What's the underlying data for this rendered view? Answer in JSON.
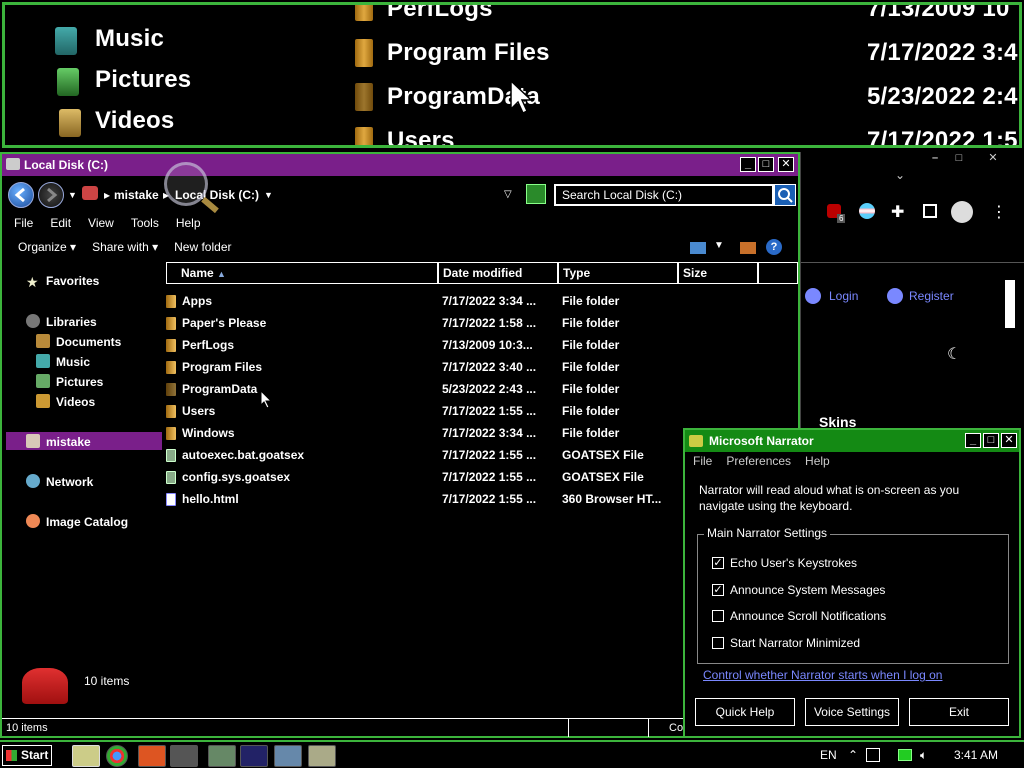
{
  "magnifier": {
    "left_items": [
      "Music",
      "Pictures",
      "Videos"
    ],
    "right_items": [
      {
        "name": "PerfLogs",
        "date": "7/13/2009 10"
      },
      {
        "name": "Program Files",
        "date": "7/17/2022 3:4"
      },
      {
        "name": "ProgramData",
        "date": "5/23/2022 2:4"
      },
      {
        "name": "Users",
        "date": "7/17/2022 1:5"
      }
    ]
  },
  "explorer": {
    "title": "Local Disk (C:)",
    "breadcrumb": [
      "mistake",
      "Local Disk (C:)"
    ],
    "search_placeholder": "Search Local Disk (C:)",
    "menu": [
      "File",
      "Edit",
      "View",
      "Tools",
      "Help"
    ],
    "toolbar": [
      "Organize",
      "Share with",
      "New folder"
    ],
    "nav": {
      "favorites": "Favorites",
      "libraries": "Libraries",
      "lib_items": [
        "Documents",
        "Music",
        "Pictures",
        "Videos"
      ],
      "user": "mistake",
      "network": "Network",
      "image_catalog": "Image Catalog"
    },
    "columns": [
      "Name",
      "Date modified",
      "Type",
      "Size"
    ],
    "files": [
      {
        "name": "Apps",
        "date": "7/17/2022 3:34 ...",
        "type": "File folder",
        "kind": "folder"
      },
      {
        "name": "Paper's Please",
        "date": "7/17/2022 1:58 ...",
        "type": "File folder",
        "kind": "folder"
      },
      {
        "name": "PerfLogs",
        "date": "7/13/2009 10:3...",
        "type": "File folder",
        "kind": "folder"
      },
      {
        "name": "Program Files",
        "date": "7/17/2022 3:40 ...",
        "type": "File folder",
        "kind": "folder"
      },
      {
        "name": "ProgramData",
        "date": "5/23/2022 2:43 ...",
        "type": "File folder",
        "kind": "folder"
      },
      {
        "name": "Users",
        "date": "7/17/2022 1:55 ...",
        "type": "File folder",
        "kind": "folder"
      },
      {
        "name": "Windows",
        "date": "7/17/2022 3:34 ...",
        "type": "File folder",
        "kind": "folder"
      },
      {
        "name": "autoexec.bat.goatsex",
        "date": "7/17/2022 1:55 ...",
        "type": "GOATSEX File",
        "kind": "file"
      },
      {
        "name": "config.sys.goatsex",
        "date": "7/17/2022 1:55 ...",
        "type": "GOATSEX File",
        "kind": "file"
      },
      {
        "name": "hello.html",
        "date": "7/17/2022 1:55 ...",
        "type": "360 Browser HT...",
        "kind": "html"
      }
    ],
    "item_count": "10 items",
    "status_count": "10 items",
    "status_right": "Cor"
  },
  "browser": {
    "badge": "6",
    "login": "Login",
    "register": "Register",
    "skins": "Skins"
  },
  "narrator": {
    "title": "Microsoft Narrator",
    "menu": [
      "File",
      "Preferences",
      "Help"
    ],
    "description": "Narrator will read aloud what is on-screen as you navigate using the keyboard.",
    "group_title": "Main Narrator Settings",
    "options": [
      {
        "label": "Echo User's Keystrokes",
        "checked": true
      },
      {
        "label": "Announce System Messages",
        "checked": true
      },
      {
        "label": "Announce Scroll Notifications",
        "checked": false
      },
      {
        "label": "Start Narrator Minimized",
        "checked": false
      }
    ],
    "link": "Control whether Narrator starts when I log on",
    "buttons": [
      "Quick Help",
      "Voice Settings",
      "Exit"
    ]
  },
  "taskbar": {
    "start": "Start",
    "lang": "EN",
    "time": "3:41 AM"
  },
  "colors": {
    "explorer_title": "#7a1f8a",
    "narrator_title": "#148a14",
    "border_green": "#3cb43c"
  }
}
